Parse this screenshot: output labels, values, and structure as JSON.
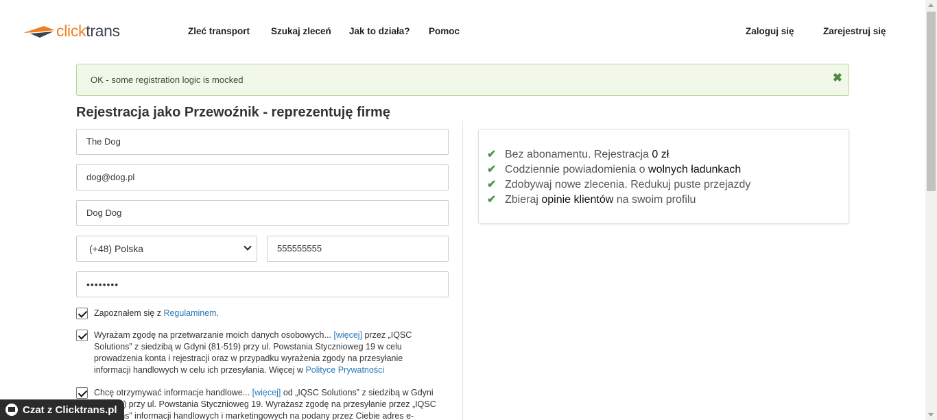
{
  "logo": {
    "text_a": "click",
    "text_b": "trans"
  },
  "nav": [
    "Zleć transport",
    "Szukaj zleceń",
    "Jak to działa?",
    "Pomoc"
  ],
  "auth": {
    "login": "Zaloguj się",
    "register": "Zarejestruj się"
  },
  "alert": {
    "text": "OK - some registration logic is mocked",
    "close": "✖"
  },
  "page_title": "Rejestracja jako Przewoźnik - reprezentuję firmę",
  "form": {
    "company": "The Dog",
    "email": "dog@dog.pl",
    "name": "Dog Dog",
    "country": "(+48) Polska",
    "phone": "555555555",
    "password": "••••••••"
  },
  "consents": [
    {
      "pre": "Zapoznałem się z ",
      "link": "Regulaminem",
      "post": "."
    },
    {
      "l1a": "Wyrażam zgodę na przetwarzanie moich danych osobowych... ",
      "l1link": "[więcej]",
      "l1b": " przez „IQSC",
      "l2": "Solutions” z siedzibą w Gdyni (81-519) przy ul. Powstania Stycznioweg 19 w celu",
      "l3": "prowadzenia konta i rejestracji oraz w przypadku wyrażenia zgody na przesyłanie",
      "l4a": "informacji handlowych w celu ich przesyłania. Więcej w ",
      "l4link": "Polityce Prywatności"
    },
    {
      "l1a": "Chcę otrzymywać informacje handlowe... ",
      "l1link": "[więcej]",
      "l1b": " od „IQSC Solutions” z siedzibą w Gdyni",
      "l2": "(81-519) przy ul. Powstania Stycznioweg 19. Wyrażasz zgodę na przesyłanie przez „IQSC",
      "l3": "Solutions” informacji handlowych i marketingowych na podany przez Ciebie adres e-"
    }
  ],
  "benefits": [
    {
      "a": "Bez abonamentu. Rejestracja ",
      "b": "0 zł",
      "c": ""
    },
    {
      "a": "Codziennie powiadomienia o ",
      "b": "wolnych ładunkach",
      "c": ""
    },
    {
      "a": "Zdobywaj nowe zlecenia. Redukuj puste przejazdy",
      "b": "",
      "c": ""
    },
    {
      "a": "Zbieraj ",
      "b": "opinie klientów",
      "c": " na swoim profilu"
    }
  ],
  "chat": {
    "label": "Czat z Clicktrans.pl"
  }
}
